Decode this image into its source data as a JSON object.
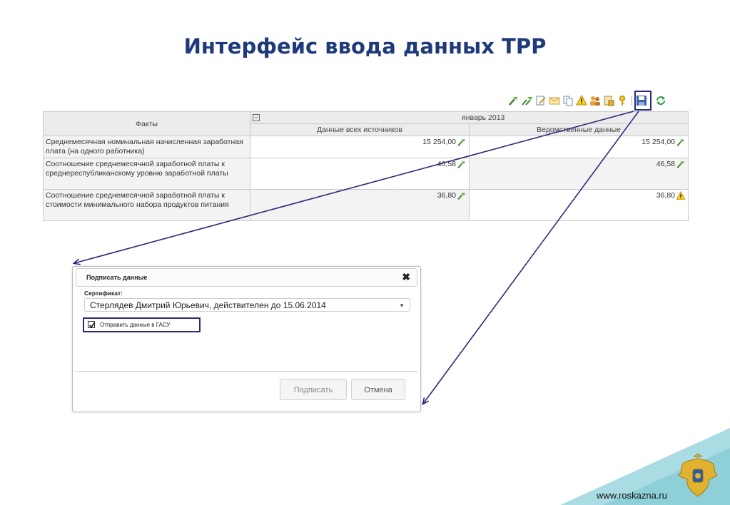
{
  "page": {
    "title": "Интерфейс ввода данных ТРР",
    "site": "www.roskazna.ru"
  },
  "toolbar": {
    "icons": [
      "sign-green-icon",
      "sign-all-green-icon",
      "edit-icon",
      "mail-icon",
      "copy-icon",
      "warning-icon",
      "users-icon",
      "lock-doc-icon",
      "key-icon",
      "save-icon",
      "refresh-icon"
    ]
  },
  "grid": {
    "facts_header": "Факты",
    "period": "январь 2013",
    "col1": "Данные всех источников",
    "col2": "Ведомственные данные",
    "rows": [
      {
        "fact": "Среднемесячная номинальная начисленная заработная плата (на одного работника)",
        "v1": "15 254,00",
        "v2": "15 254,00",
        "s1": "ok",
        "s2": "ok"
      },
      {
        "fact": "Соотношение среднемесячной заработной платы к среднереспубликанскому уровню заработной платы",
        "v1": "46,58",
        "v2": "46,58",
        "s1": "ok",
        "s2": "ok"
      },
      {
        "fact": "Соотношение среднемесячной заработной платы к стоимости минимального набора продуктов питания",
        "v1": "36,80",
        "v2": "36,80",
        "s1": "ok",
        "s2": "warning"
      }
    ]
  },
  "dialog": {
    "title": "Подписать данные",
    "close": "✖",
    "cert_label": "Сертификат:",
    "cert_value": "Стерлядев Дмитрий Юрьевич, действителен до 15.06.2014",
    "checkbox_label": "Отправить данные в ГАСУ",
    "checkbox_checked": true,
    "sign_button": "Подписать",
    "cancel_button": "Отмена"
  },
  "colors": {
    "title": "#1f3a7a",
    "highlight": "#2b2a78",
    "accent_teal": "#8fcfd7"
  }
}
